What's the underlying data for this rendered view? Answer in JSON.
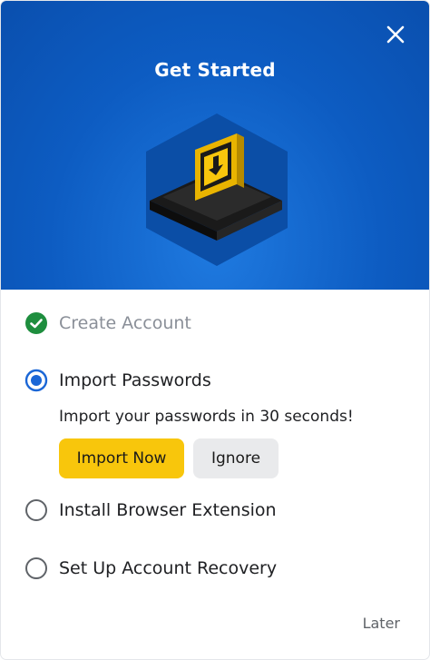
{
  "header": {
    "title": "Get Started",
    "close_icon": "close-icon",
    "background_color": "#0d5cc2"
  },
  "steps": [
    {
      "label": "Create Account",
      "status": "completed",
      "icon": "check-circle-icon"
    },
    {
      "label": "Import Passwords",
      "status": "active",
      "icon": "radio-selected-icon"
    },
    {
      "label": "Install Browser Extension",
      "status": "pending",
      "icon": "radio-empty-icon"
    },
    {
      "label": "Set Up Account Recovery",
      "status": "pending",
      "icon": "radio-empty-icon"
    }
  ],
  "active_step": {
    "description": "Import your passwords in 30 seconds!",
    "primary_button": "Import Now",
    "secondary_button": "Ignore"
  },
  "footer": {
    "later_label": "Later"
  },
  "colors": {
    "accent_yellow": "#f8c60c",
    "success_green": "#1e8e3e",
    "radio_blue": "#1a66d6"
  }
}
